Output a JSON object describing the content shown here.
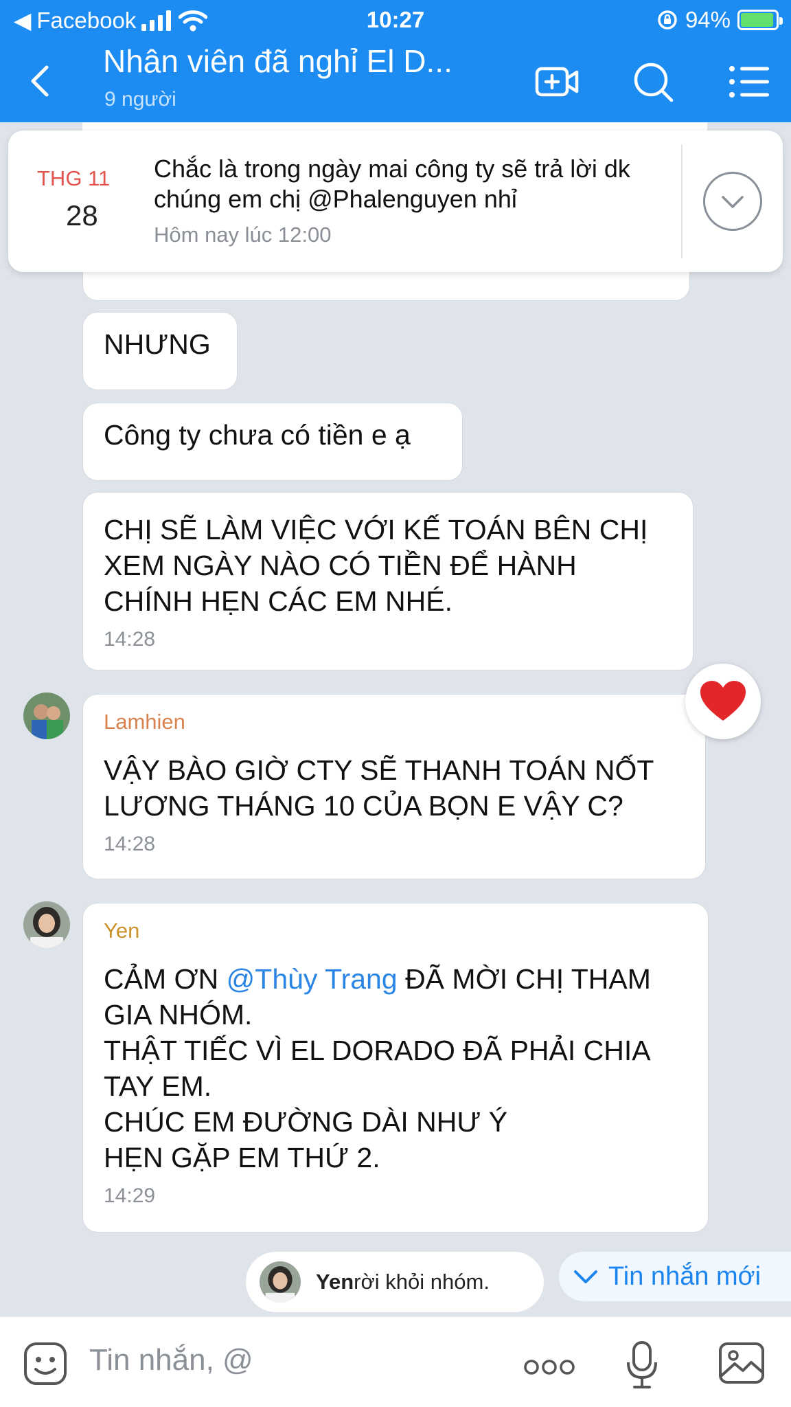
{
  "status_bar": {
    "back_app": "Facebook",
    "time": "10:27",
    "battery": "94%"
  },
  "header": {
    "title": "Nhân viên đã nghỉ El D...",
    "subtitle": "9 người"
  },
  "pinned": {
    "month": "THG 11",
    "day": "28",
    "text": "Chắc là trong ngày mai công ty sẽ trả lời dk chúng em chị @Phalenguyen nhỉ",
    "time": "Hôm nay lúc 12:00"
  },
  "messages": [
    {
      "text": "NHƯNG"
    },
    {
      "text": "Công ty chưa có tiền e ạ"
    },
    {
      "text": "CHỊ SẼ LÀM VIỆC VỚI KẾ TOÁN BÊN CHỊ XEM NGÀY NÀO CÓ TIỀN ĐỂ HÀNH CHÍNH HẸN CÁC EM NHÉ.",
      "time": "14:28"
    },
    {
      "sender": "Lamhien",
      "text": "VẬY BÀO GIỜ CTY SẼ THANH TOÁN NỐT LƯƠNG THÁNG 10 CỦA BỌN E VẬY C?",
      "time": "14:28"
    },
    {
      "sender": "Yen",
      "text_before": "CẢM ƠN ",
      "mention": "@Thùy Trang",
      "text_after": " ĐÃ MỜI CHỊ THAM GIA NHÓM.",
      "lines": [
        "THẬT TIẾC VÌ EL DORADO ĐÃ PHẢI CHIA TAY EM.",
        "CHÚC EM ĐƯỜNG DÀI NHƯ Ý",
        "HẸN GẶP EM THỨ 2."
      ],
      "time": "14:29"
    }
  ],
  "system": {
    "name": "Yen",
    "action": " rời khỏi nhóm."
  },
  "new_messages_label": "Tin nhắn mới",
  "input": {
    "placeholder": "Tin nhắn, @"
  },
  "colors": {
    "header_blue": "#1c8cf3",
    "sender_lamhien": "#d8834f",
    "sender_yen": "#c9922a",
    "mention": "#2b85e4",
    "month_red": "#e2554f"
  }
}
